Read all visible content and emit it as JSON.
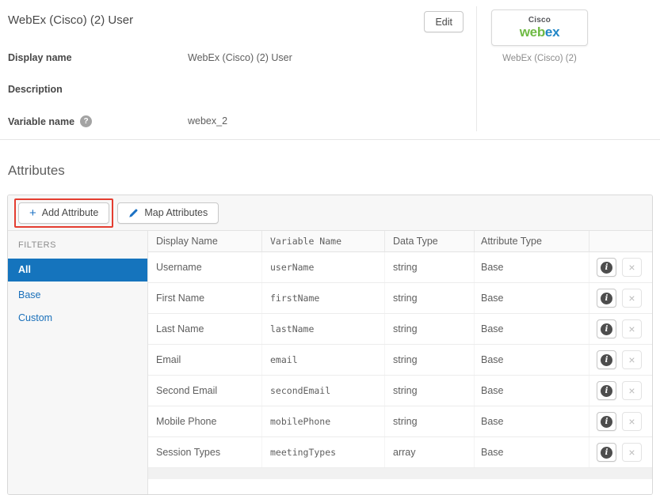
{
  "header": {
    "title": "WebEx (Cisco) (2) User",
    "edit_button": "Edit",
    "fields": [
      {
        "label": "Display name",
        "value": "WebEx (Cisco) (2) User"
      },
      {
        "label": "Description",
        "value": ""
      },
      {
        "label": "Variable name",
        "value": "webex_2",
        "has_help": true
      }
    ],
    "logo": {
      "brand_top": "Cisco",
      "brand_web": "web",
      "brand_ex": "ex",
      "caption": "WebEx (Cisco) (2)"
    }
  },
  "attributes_section": {
    "heading": "Attributes",
    "toolbar": {
      "add_button": "Add Attribute",
      "map_button": "Map Attributes"
    },
    "filters": {
      "label": "FILTERS",
      "items": [
        {
          "label": "All",
          "selected": true
        },
        {
          "label": "Base",
          "selected": false
        },
        {
          "label": "Custom",
          "selected": false
        }
      ]
    },
    "table": {
      "columns": [
        "Display Name",
        "Variable Name",
        "Data Type",
        "Attribute Type"
      ],
      "rows": [
        {
          "display_name": "Username",
          "variable_name": "userName",
          "data_type": "string",
          "attribute_type": "Base"
        },
        {
          "display_name": "First Name",
          "variable_name": "firstName",
          "data_type": "string",
          "attribute_type": "Base"
        },
        {
          "display_name": "Last Name",
          "variable_name": "lastName",
          "data_type": "string",
          "attribute_type": "Base"
        },
        {
          "display_name": "Email",
          "variable_name": "email",
          "data_type": "string",
          "attribute_type": "Base"
        },
        {
          "display_name": "Second Email",
          "variable_name": "secondEmail",
          "data_type": "string",
          "attribute_type": "Base"
        },
        {
          "display_name": "Mobile Phone",
          "variable_name": "mobilePhone",
          "data_type": "string",
          "attribute_type": "Base"
        },
        {
          "display_name": "Session Types",
          "variable_name": "meetingTypes",
          "data_type": "array",
          "attribute_type": "Base"
        }
      ]
    }
  },
  "icons": {
    "add": "+",
    "help": "?",
    "info": "i",
    "remove": "×"
  },
  "colors": {
    "selected_filter_bg": "#1574bd",
    "link_blue": "#1a70ba",
    "accent_blue": "#1c72c4",
    "annotation_red": "#e43d30",
    "webex_green": "#6fba44",
    "webex_blue": "#2186c6",
    "info_circle": "#4d4d4d"
  }
}
